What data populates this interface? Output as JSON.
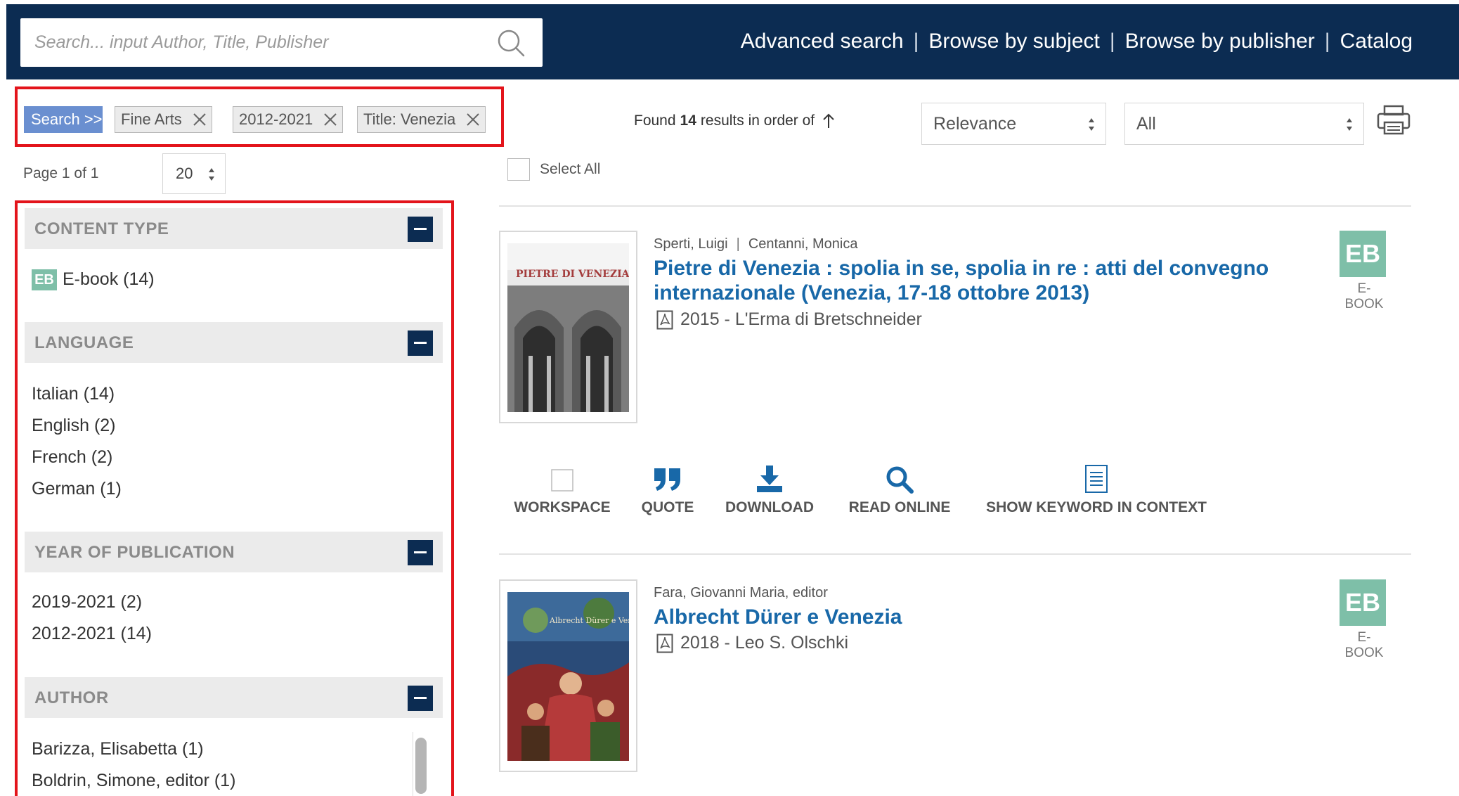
{
  "header": {
    "search_placeholder": "Search... input Author, Title, Publisher",
    "nav": [
      "Advanced search",
      "Browse by subject",
      "Browse by publisher",
      "Catalog"
    ]
  },
  "filters": {
    "search_label": "Search >>",
    "chips": [
      "Fine Arts",
      "2012-2021",
      "Title: Venezia"
    ]
  },
  "results_meta": {
    "found_prefix": "Found",
    "count": "14",
    "found_suffix": "results in order of",
    "sort_value": "Relevance",
    "filter_value": "All",
    "page_info": "Page 1 of 1",
    "per_page": "20",
    "select_all": "Select All"
  },
  "facets": {
    "content_type": {
      "title": "CONTENT TYPE",
      "badge": "EB",
      "items": [
        "E-book (14)"
      ]
    },
    "language": {
      "title": "LANGUAGE",
      "items": [
        "Italian (14)",
        "English (2)",
        "French (2)",
        "German (1)"
      ]
    },
    "year": {
      "title": "YEAR OF PUBLICATION",
      "items": [
        "2019-2021  (2)",
        "2012-2021  (14)"
      ]
    },
    "author": {
      "title": "AUTHOR",
      "items": [
        "Barizza, Elisabetta (1)",
        "Boldrin, Simone, editor (1)"
      ]
    }
  },
  "results": [
    {
      "authors": [
        "Sperti, Luigi",
        "Centanni, Monica"
      ],
      "title": "Pietre di Venezia : spolia in se, spolia in re : atti del convegno internazionale (Venezia, 17-18 ottobre 2013)",
      "pub": "2015 - L'Erma di Bretschneider",
      "badge": "EB",
      "badge_label": "E-BOOK",
      "cover_text": "PIETRE DI VENEZIA"
    },
    {
      "authors": [
        "Fara, Giovanni Maria, editor"
      ],
      "title": "Albrecht Dürer e Venezia",
      "pub": "2018 - Leo S. Olschki",
      "badge": "EB",
      "badge_label": "E-BOOK",
      "cover_text": "Albrecht Dürer e Venezia"
    }
  ],
  "actions": [
    "WORKSPACE",
    "QUOTE",
    "DOWNLOAD",
    "READ ONLINE",
    "SHOW KEYWORD IN CONTEXT"
  ],
  "colors": {
    "header_bg": "#0c2c52",
    "title_link": "#1868a8",
    "ebook_badge": "#7ebfa8",
    "highlight_frame": "#e3141b",
    "search_chip": "#6a8fd0"
  }
}
